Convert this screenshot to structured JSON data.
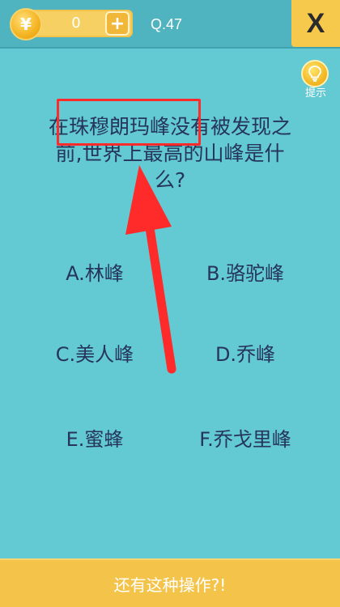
{
  "header": {
    "coin_symbol": "¥",
    "coin_count": "0",
    "add_symbol": "+",
    "level": "Q.47",
    "close_symbol": "X"
  },
  "hint": {
    "label": "提示"
  },
  "question": {
    "text": "在珠穆朗玛峰没有被发现之前,世界上最高的山峰是什么?"
  },
  "options": [
    {
      "label": "A.林峰"
    },
    {
      "label": "B.骆驼峰"
    },
    {
      "label": "C.美人峰"
    },
    {
      "label": "D.乔峰"
    },
    {
      "label": "E.蜜蜂"
    },
    {
      "label": "F.乔戈里峰"
    }
  ],
  "footer": {
    "label": "还有这种操作?!"
  },
  "colors": {
    "background": "#63c9d2",
    "text": "#26355a",
    "accent": "#f4c44a",
    "annotation": "#ff2a2a"
  }
}
